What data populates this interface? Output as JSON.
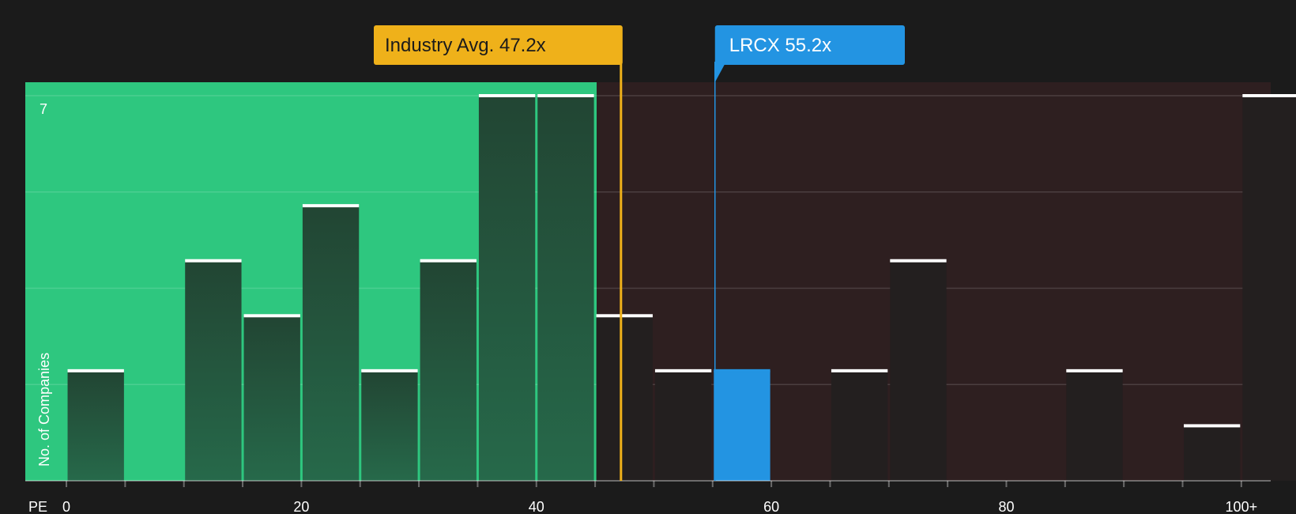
{
  "chart_data": {
    "type": "bar",
    "xlabel": "PE",
    "ylabel": "No. of Companies",
    "x_tick_labels": [
      "0",
      "20",
      "40",
      "60",
      "80",
      "100+"
    ],
    "y_tick_label": "7",
    "xlim": [
      -3.5,
      102.5
    ],
    "ylim": [
      0,
      7
    ],
    "bin_width": 5,
    "bins": [
      {
        "start": 0,
        "value": 2
      },
      {
        "start": 5,
        "value": 0
      },
      {
        "start": 10,
        "value": 4
      },
      {
        "start": 15,
        "value": 3
      },
      {
        "start": 20,
        "value": 5
      },
      {
        "start": 25,
        "value": 2
      },
      {
        "start": 30,
        "value": 4
      },
      {
        "start": 35,
        "value": 7
      },
      {
        "start": 40,
        "value": 7
      },
      {
        "start": 45,
        "value": 3
      },
      {
        "start": 50,
        "value": 2
      },
      {
        "start": 55,
        "value": 2,
        "highlight": true
      },
      {
        "start": 60,
        "value": 0
      },
      {
        "start": 65,
        "value": 2
      },
      {
        "start": 70,
        "value": 4
      },
      {
        "start": 75,
        "value": 0
      },
      {
        "start": 80,
        "value": 0
      },
      {
        "start": 85,
        "value": 2
      },
      {
        "start": 90,
        "value": 0
      },
      {
        "start": 95,
        "value": 1
      },
      {
        "start": 100,
        "value": 7
      }
    ],
    "fair_zone_end": 45,
    "industry_avg": {
      "label": "Industry Avg. 47.2x",
      "value": 47.2
    },
    "company": {
      "label": "LRCX 55.2x",
      "value": 55.2
    },
    "colors": {
      "background": "#1b1b1b",
      "fair_zone": "#2ec77f",
      "expensive_zone": "#2e1f20",
      "bar_dark_top": "#224533",
      "bar_dark_bottom": "#26694a",
      "bar_neutral": "#231f1f",
      "bar_highlight": "#2394e2",
      "industry_avg": "#efb11a",
      "company": "#2394e2",
      "cap": "#ffffff"
    }
  }
}
